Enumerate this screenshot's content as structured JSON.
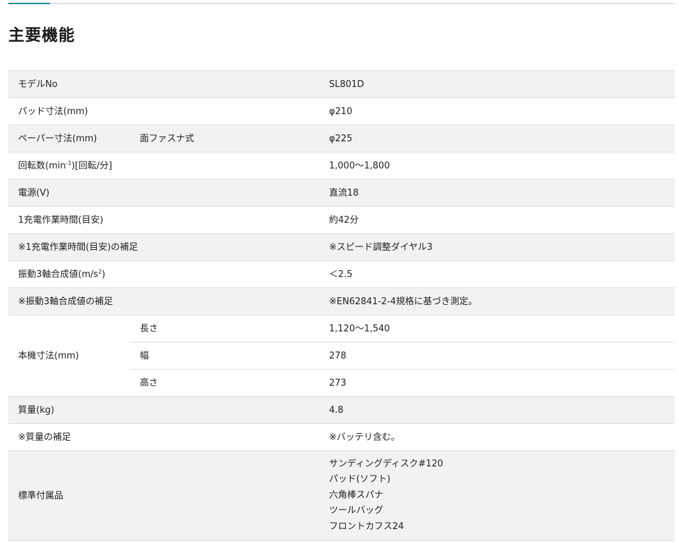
{
  "page": {
    "title": "主要機能"
  },
  "spec": {
    "rows": [
      {
        "label": "モデルNo",
        "sub": "",
        "value": "SL801D"
      },
      {
        "label": "パッド寸法(mm)",
        "sub": "",
        "value": "φ210"
      },
      {
        "label": "ペーパー寸法(mm)",
        "sub": "面ファスナ式",
        "value": "φ225"
      },
      {
        "label_pre": "回転数(min",
        "label_sup": "-1",
        "label_post": ")[回転/分]",
        "value": "1,000〜1,800"
      },
      {
        "label": "電源(V)",
        "sub": "",
        "value": "直流18"
      },
      {
        "label": "1充電作業時間(目安)",
        "sub": "",
        "value": "約42分"
      },
      {
        "label": "※1充電作業時間(目安)の補足",
        "sub": "",
        "value": "※スピード調整ダイヤル3"
      },
      {
        "label_pre": "振動3軸合成値(m/s",
        "label_sup": "2",
        "label_post": ")",
        "value": "＜2.5"
      },
      {
        "label": "※振動3軸合成値の補足",
        "sub": "",
        "value": "※EN62841-2-4規格に基づき測定。"
      }
    ],
    "dimensions": {
      "label": "本機寸法(mm)",
      "items": [
        {
          "sub": "長さ",
          "value": "1,120〜1,540"
        },
        {
          "sub": "幅",
          "value": "278"
        },
        {
          "sub": "高さ",
          "value": "273"
        }
      ]
    },
    "weight": {
      "label": "質量(kg)",
      "value": "4.8"
    },
    "weight_note": {
      "label": "※質量の補足",
      "value": "※バッテリ含む。"
    },
    "accessories": {
      "label": "標準付属品",
      "items": [
        "サンディングディスク#120",
        "パッド(ソフト)",
        "六角棒スパナ",
        "ツールバッグ",
        "フロントカフス24"
      ]
    }
  }
}
